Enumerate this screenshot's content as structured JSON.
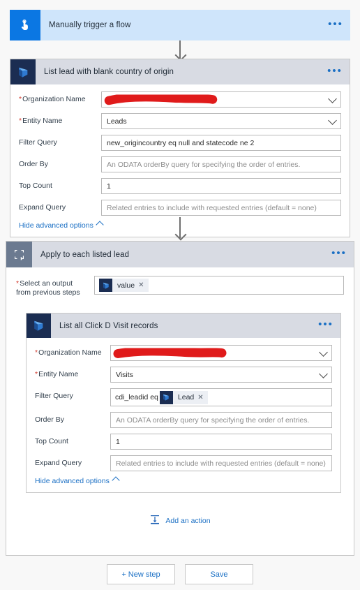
{
  "app": {
    "background": "#f8f8f8",
    "accent": "#1a6fc4",
    "required_marker": "*",
    "overflow_menu_label": "•••"
  },
  "trigger": {
    "icon": "touch-trigger-icon",
    "title": "Manually trigger a flow",
    "header_color": "#cfe5fb",
    "icon_color": "#0b77e3"
  },
  "list_lead_action": {
    "icon": "dynamics365-icon",
    "title": "List lead with blank country of origin",
    "header_color": "#d8dbe3",
    "fields": [
      {
        "label": "Organization Name",
        "required": true,
        "type": "combo",
        "value": "",
        "redacted": true
      },
      {
        "label": "Entity Name",
        "required": true,
        "type": "combo",
        "value": "Leads",
        "redacted": false
      },
      {
        "label": "Filter Query",
        "required": false,
        "type": "text",
        "value": "new_origincountry eq null and statecode ne 2",
        "redacted": false
      },
      {
        "label": "Order By",
        "required": false,
        "type": "text",
        "value": "",
        "placeholder": "An ODATA orderBy query for specifying the order of entries.",
        "redacted": false
      },
      {
        "label": "Top Count",
        "required": false,
        "type": "text",
        "value": "1",
        "redacted": false
      },
      {
        "label": "Expand Query",
        "required": false,
        "type": "text",
        "value": "",
        "placeholder": "Related entries to include with requested entries (default = none)",
        "redacted": false
      }
    ],
    "advanced_toggle": "Hide advanced options"
  },
  "apply_to_each": {
    "icon": "loop-foreach-icon",
    "title": "Apply to each listed lead",
    "header_color": "#d8dbe3",
    "icon_color": "#6b7a90",
    "output_label_line1": "Select an output",
    "output_label_line2": "from previous steps",
    "output_required": true,
    "output_token": {
      "text": "value",
      "icon": "dynamics365-icon",
      "remove": "✕"
    }
  },
  "list_visits_action": {
    "icon": "dynamics365-icon",
    "title": "List all Click D Visit records",
    "header_color": "#d8dbe3",
    "fields": [
      {
        "label": "Organization Name",
        "required": true,
        "type": "combo",
        "value": "",
        "redacted": true
      },
      {
        "label": "Entity Name",
        "required": true,
        "type": "combo",
        "value": "Visits",
        "redacted": false
      },
      {
        "label": "Filter Query",
        "required": false,
        "type": "token",
        "value": "cdi_leadid eq",
        "token": {
          "text": "Lead",
          "icon": "dynamics365-icon",
          "remove": "✕"
        },
        "redacted": false
      },
      {
        "label": "Order By",
        "required": false,
        "type": "text",
        "value": "",
        "placeholder": "An ODATA orderBy query for specifying the order of entries.",
        "redacted": false
      },
      {
        "label": "Top Count",
        "required": false,
        "type": "text",
        "value": "1",
        "redacted": false
      },
      {
        "label": "Expand Query",
        "required": false,
        "type": "text",
        "value": "",
        "placeholder": "Related entries to include with requested entries (default = none)",
        "redacted": false
      }
    ],
    "advanced_toggle": "Hide advanced options"
  },
  "add_action": {
    "label": "Add an action",
    "icon": "insert-action-icon"
  },
  "footer": {
    "new_step_label": "+ New step",
    "save_label": "Save"
  }
}
